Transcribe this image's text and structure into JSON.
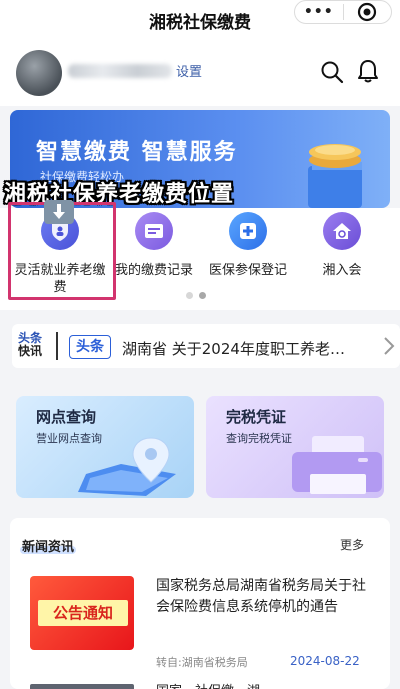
{
  "app": {
    "title": "湘税社保缴费"
  },
  "capsule": {
    "more_label": "•••"
  },
  "user": {
    "link_label": "设置"
  },
  "banner": {
    "headline": "智慧缴费 智慧服务",
    "sub": "社保缴费轻松办",
    "overlay_title": "湘税社保养老缴费位置"
  },
  "quick_menu": {
    "items": [
      {
        "label": "灵活就业养老缴费",
        "icon": "person-shield-icon"
      },
      {
        "label": "我的缴费记录",
        "icon": "records-icon"
      },
      {
        "label": "医保参保登记",
        "icon": "medical-plus-icon"
      },
      {
        "label": "湘入会",
        "icon": "house-globe-icon"
      }
    ],
    "page_index": 1,
    "page_count": 2
  },
  "ticker": {
    "logo_line1": "头条",
    "logo_line2": "快讯",
    "tag": "头条",
    "text": "湖南省 关于2024年度职工养老…"
  },
  "cards": [
    {
      "title": "网点查询",
      "sub": "营业网点查询"
    },
    {
      "title": "完税凭证",
      "sub": "查询完税凭证"
    }
  ],
  "news": {
    "title": "新闻资讯",
    "more": "更多",
    "items": [
      {
        "thumb_text": "公告通知",
        "headline": "国家税务总局湖南省税务局关于社会保险费信息系统停机的通告",
        "source": "转自:湖南省税务局",
        "date": "2024-08-22"
      }
    ],
    "next_partial": "国家…社保缴…湖…"
  },
  "colors": {
    "brand_blue": "#2f67d6",
    "highlight_pink": "#d2346e",
    "date_blue": "#3a62c6"
  }
}
